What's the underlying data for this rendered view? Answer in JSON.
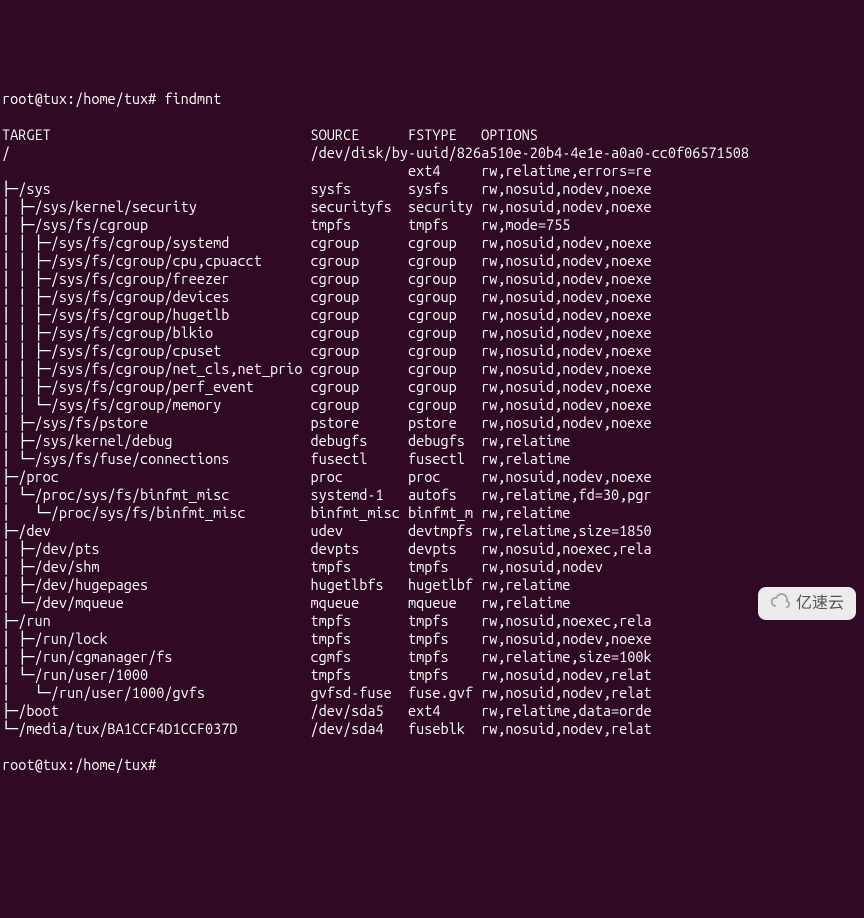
{
  "prompt_top": "root@tux:/home/tux# findmnt",
  "prompt_bottom": "root@tux:/home/tux# ",
  "watermark": "亿速云",
  "headers": {
    "target": "TARGET",
    "source": "SOURCE",
    "fstype": "FSTYPE",
    "options": "OPTIONS"
  },
  "rows": [
    {
      "tree": "/",
      "source": "/dev/disk/by-uuid/826a510e-20b4-4e1e-a0a0-cc0f06571508",
      "fstype": "",
      "options": ""
    },
    {
      "tree": "",
      "source": "",
      "fstype": "ext4",
      "options": "rw,relatime,errors=re"
    },
    {
      "tree": "├─/sys",
      "source": "sysfs",
      "fstype": "sysfs",
      "options": "rw,nosuid,nodev,noexe"
    },
    {
      "tree": "│ ├─/sys/kernel/security",
      "source": "securityfs",
      "fstype": "security",
      "options": "rw,nosuid,nodev,noexe"
    },
    {
      "tree": "│ ├─/sys/fs/cgroup",
      "source": "tmpfs",
      "fstype": "tmpfs",
      "options": "rw,mode=755"
    },
    {
      "tree": "│ │ ├─/sys/fs/cgroup/systemd",
      "source": "cgroup",
      "fstype": "cgroup",
      "options": "rw,nosuid,nodev,noexe"
    },
    {
      "tree": "│ │ ├─/sys/fs/cgroup/cpu,cpuacct",
      "source": "cgroup",
      "fstype": "cgroup",
      "options": "rw,nosuid,nodev,noexe"
    },
    {
      "tree": "│ │ ├─/sys/fs/cgroup/freezer",
      "source": "cgroup",
      "fstype": "cgroup",
      "options": "rw,nosuid,nodev,noexe"
    },
    {
      "tree": "│ │ ├─/sys/fs/cgroup/devices",
      "source": "cgroup",
      "fstype": "cgroup",
      "options": "rw,nosuid,nodev,noexe"
    },
    {
      "tree": "│ │ ├─/sys/fs/cgroup/hugetlb",
      "source": "cgroup",
      "fstype": "cgroup",
      "options": "rw,nosuid,nodev,noexe"
    },
    {
      "tree": "│ │ ├─/sys/fs/cgroup/blkio",
      "source": "cgroup",
      "fstype": "cgroup",
      "options": "rw,nosuid,nodev,noexe"
    },
    {
      "tree": "│ │ ├─/sys/fs/cgroup/cpuset",
      "source": "cgroup",
      "fstype": "cgroup",
      "options": "rw,nosuid,nodev,noexe"
    },
    {
      "tree": "│ │ ├─/sys/fs/cgroup/net_cls,net_prio",
      "source": "cgroup",
      "fstype": "cgroup",
      "options": "rw,nosuid,nodev,noexe"
    },
    {
      "tree": "│ │ ├─/sys/fs/cgroup/perf_event",
      "source": "cgroup",
      "fstype": "cgroup",
      "options": "rw,nosuid,nodev,noexe"
    },
    {
      "tree": "│ │ └─/sys/fs/cgroup/memory",
      "source": "cgroup",
      "fstype": "cgroup",
      "options": "rw,nosuid,nodev,noexe"
    },
    {
      "tree": "│ ├─/sys/fs/pstore",
      "source": "pstore",
      "fstype": "pstore",
      "options": "rw,nosuid,nodev,noexe"
    },
    {
      "tree": "│ ├─/sys/kernel/debug",
      "source": "debugfs",
      "fstype": "debugfs",
      "options": "rw,relatime"
    },
    {
      "tree": "│ └─/sys/fs/fuse/connections",
      "source": "fusectl",
      "fstype": "fusectl",
      "options": "rw,relatime"
    },
    {
      "tree": "├─/proc",
      "source": "proc",
      "fstype": "proc",
      "options": "rw,nosuid,nodev,noexe"
    },
    {
      "tree": "│ └─/proc/sys/fs/binfmt_misc",
      "source": "systemd-1",
      "fstype": "autofs",
      "options": "rw,relatime,fd=30,pgr"
    },
    {
      "tree": "│   └─/proc/sys/fs/binfmt_misc",
      "source": "binfmt_misc",
      "fstype": "binfmt_m",
      "options": "rw,relatime"
    },
    {
      "tree": "├─/dev",
      "source": "udev",
      "fstype": "devtmpfs",
      "options": "rw,relatime,size=1850"
    },
    {
      "tree": "│ ├─/dev/pts",
      "source": "devpts",
      "fstype": "devpts",
      "options": "rw,nosuid,noexec,rela"
    },
    {
      "tree": "│ ├─/dev/shm",
      "source": "tmpfs",
      "fstype": "tmpfs",
      "options": "rw,nosuid,nodev"
    },
    {
      "tree": "│ ├─/dev/hugepages",
      "source": "hugetlbfs",
      "fstype": "hugetlbf",
      "options": "rw,relatime"
    },
    {
      "tree": "│ └─/dev/mqueue",
      "source": "mqueue",
      "fstype": "mqueue",
      "options": "rw,relatime"
    },
    {
      "tree": "├─/run",
      "source": "tmpfs",
      "fstype": "tmpfs",
      "options": "rw,nosuid,noexec,rela"
    },
    {
      "tree": "│ ├─/run/lock",
      "source": "tmpfs",
      "fstype": "tmpfs",
      "options": "rw,nosuid,nodev,noexe"
    },
    {
      "tree": "│ ├─/run/cgmanager/fs",
      "source": "cgmfs",
      "fstype": "tmpfs",
      "options": "rw,relatime,size=100k"
    },
    {
      "tree": "│ └─/run/user/1000",
      "source": "tmpfs",
      "fstype": "tmpfs",
      "options": "rw,nosuid,nodev,relat"
    },
    {
      "tree": "│   └─/run/user/1000/gvfs",
      "source": "gvfsd-fuse",
      "fstype": "fuse.gvf",
      "options": "rw,nosuid,nodev,relat"
    },
    {
      "tree": "├─/boot",
      "source": "/dev/sda5",
      "fstype": "ext4",
      "options": "rw,relatime,data=orde"
    },
    {
      "tree": "└─/media/tux/BA1CCF4D1CCF037D",
      "source": "/dev/sda4",
      "fstype": "fuseblk",
      "options": "rw,nosuid,nodev,relat"
    }
  ],
  "columns": {
    "target_pad": 38,
    "source_pad": 12,
    "fstype_pad": 9
  }
}
